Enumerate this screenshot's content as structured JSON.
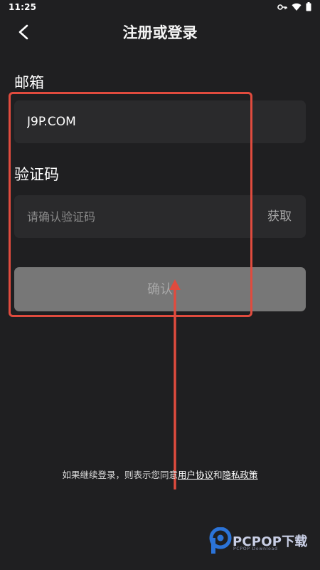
{
  "status_bar": {
    "time": "11:25",
    "icons": [
      "key-icon",
      "wifi-icon",
      "battery-icon"
    ]
  },
  "header": {
    "title": "注册或登录",
    "back_icon": "chevron-left-icon"
  },
  "form": {
    "email_label": "邮箱",
    "email_value": "J9P.COM",
    "code_label": "验证码",
    "code_placeholder": "请确认验证码",
    "get_code_label": "获取",
    "confirm_label": "确认"
  },
  "agreement": {
    "prefix": "如果继续登录，则表示您同意",
    "user_agreement": "用户协议",
    "connector": "和",
    "privacy_policy": "隐私政策"
  },
  "watermark": {
    "text": "PCPOP下载",
    "subtext": "PCPOP Download"
  },
  "colors": {
    "background": "#1f1f21",
    "field": "#2a2a2c",
    "button": "#777777",
    "annotation": "#e04b3e",
    "watermark_blue": "#2b73d8"
  }
}
